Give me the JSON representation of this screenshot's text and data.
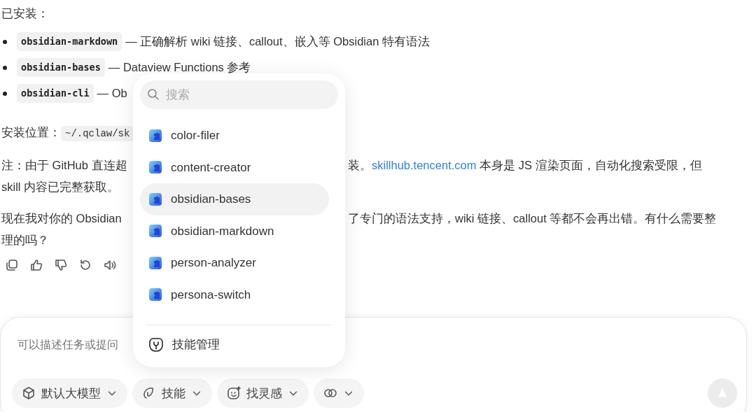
{
  "message": {
    "heading": "已安装：",
    "skills": [
      {
        "name": "obsidian-markdown",
        "description": "— 正确解析 wiki 链接、callout、嵌入等 Obsidian 特有语法"
      },
      {
        "name": "obsidian-bases",
        "description": "— Dataview Functions 参考"
      },
      {
        "name": "obsidian-cli",
        "description": "— Ob"
      }
    ],
    "install_location": {
      "label": "安装位置：",
      "path": "~/.qclaw/sk"
    },
    "note": {
      "left": "注：由于 GitHub 直连超",
      "right_before": "装。",
      "link": "skillhub.tencent.com",
      "right_after": " 本身是 JS 渲染页面，自动化搜索受限，但",
      "continuation": "skill 内容已完整获取。"
    },
    "summary": {
      "left": "现在我对你的 Obsidian",
      "right": "了专门的语法支持，wiki 链接、callout 等都不会再出错。有什么需要整",
      "continuation": "理的吗？"
    }
  },
  "skill_menu": {
    "search": {
      "placeholder": "搜索"
    },
    "items": [
      {
        "label": "color-filer",
        "selected": false
      },
      {
        "label": "content-creator",
        "selected": false
      },
      {
        "label": "obsidian-bases",
        "selected": true
      },
      {
        "label": "obsidian-markdown",
        "selected": false
      },
      {
        "label": "person-analyzer",
        "selected": false
      },
      {
        "label": "persona-switch",
        "selected": false
      }
    ],
    "manage": "技能管理"
  },
  "composer": {
    "placeholder": "可以描述任务或提问",
    "tools": [
      {
        "kind": "model",
        "label": "默认大模型"
      },
      {
        "kind": "skills",
        "label": "技能"
      },
      {
        "kind": "inspire",
        "label": "找灵感"
      },
      {
        "kind": "link"
      }
    ],
    "send_disabled": true
  }
}
